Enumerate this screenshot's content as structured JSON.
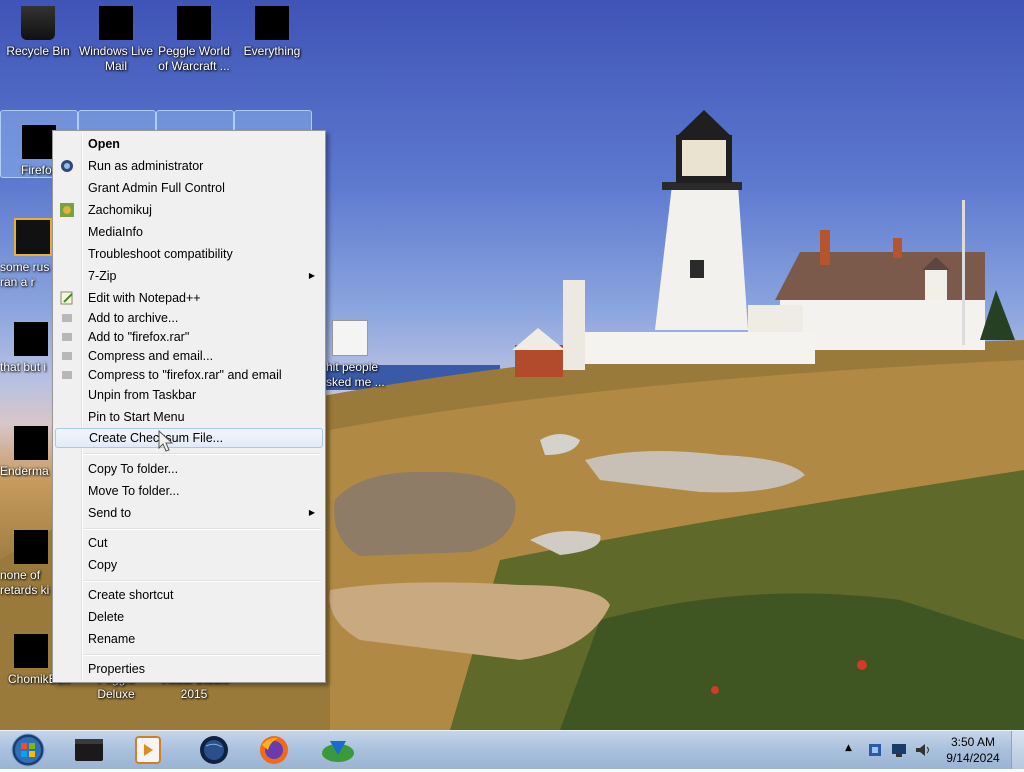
{
  "desktop_icons": [
    {
      "label": "Recycle Bin"
    },
    {
      "label": "Windows Live Mail"
    },
    {
      "label": "Peggle World of Warcraft ..."
    },
    {
      "label": "Everything"
    },
    {
      "label": "Firefox"
    },
    {
      "label": "some rus ran a r"
    },
    {
      "label": "that but i"
    },
    {
      "label": "Enderma"
    },
    {
      "label": "none of retards ki"
    },
    {
      "label": "ChomikBox"
    },
    {
      "label": "Peggle Deluxe"
    },
    {
      "label": "Visual Studio 2015"
    },
    {
      "label": "hit people sked me ..."
    }
  ],
  "context_menu": {
    "items": [
      {
        "label": "Open"
      },
      {
        "label": "Run as administrator"
      },
      {
        "label": "Grant Admin Full Control"
      },
      {
        "label": "Zachomikuj"
      },
      {
        "label": "MediaInfo"
      },
      {
        "label": "Troubleshoot compatibility"
      },
      {
        "label": "7-Zip"
      },
      {
        "label": "Edit with Notepad++"
      },
      {
        "label": "Add to archive..."
      },
      {
        "label": "Add to \"firefox.rar\""
      },
      {
        "label": "Compress and email..."
      },
      {
        "label": "Compress to \"firefox.rar\" and email"
      },
      {
        "label": "Unpin from Taskbar"
      },
      {
        "label": "Pin to Start Menu"
      },
      {
        "label": "Create Checksum File..."
      },
      {
        "label": "Copy To folder..."
      },
      {
        "label": "Move To folder..."
      },
      {
        "label": "Send to"
      },
      {
        "label": "Cut"
      },
      {
        "label": "Copy"
      },
      {
        "label": "Create shortcut"
      },
      {
        "label": "Delete"
      },
      {
        "label": "Rename"
      },
      {
        "label": "Properties"
      }
    ],
    "hovered": "Create Checksum File..."
  },
  "taskbar": {
    "pinned": [
      "start-orb",
      "media-center-icon",
      "media-player-icon",
      "globe-icon",
      "firefox-icon",
      "download-manager-icon"
    ],
    "tray": {
      "time": "3:50 AM",
      "date": "9/14/2024"
    }
  },
  "colors": {
    "menu_bg": "#f0f0f0",
    "menu_hover_border": "#a8c8ec",
    "taskbar": "#a9c0dd",
    "sky": "#4a64c4"
  }
}
